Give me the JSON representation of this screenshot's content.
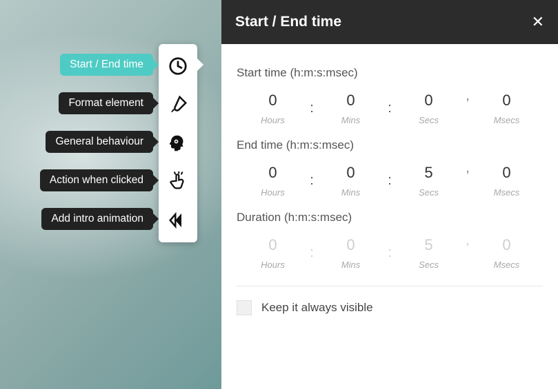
{
  "panel": {
    "title": "Start / End time"
  },
  "labels": {
    "start_time": "Start time (h:m:s:msec)",
    "end_time": "End time (h:m:s:msec)",
    "duration": "Duration (h:m:s:msec)",
    "hours": "Hours",
    "mins": "Mins",
    "secs": "Secs",
    "msecs": "Msecs",
    "keep_visible": "Keep it always visible"
  },
  "start": {
    "h": "0",
    "m": "0",
    "s": "0",
    "ms": "0"
  },
  "end": {
    "h": "0",
    "m": "0",
    "s": "5",
    "ms": "0"
  },
  "duration": {
    "h": "0",
    "m": "0",
    "s": "5",
    "ms": "0"
  },
  "tooltips": {
    "start_end": "Start / End time",
    "format": "Format element",
    "behaviour": "General behaviour",
    "action": "Action when clicked",
    "intro": "Add intro animation"
  }
}
